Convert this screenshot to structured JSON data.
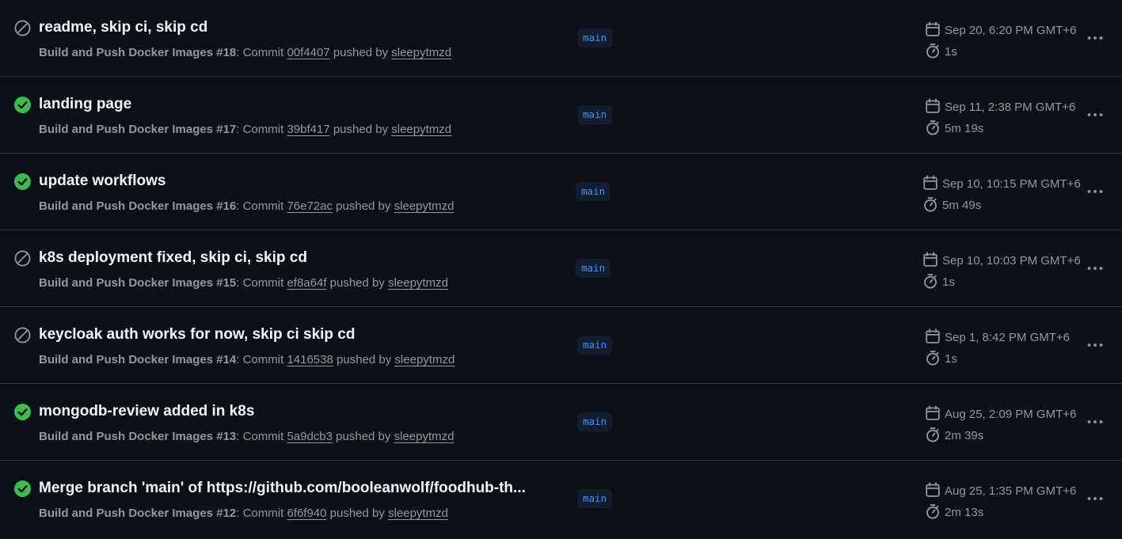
{
  "runs": [
    {
      "status": "skipped",
      "title": "readme, skip ci, skip cd",
      "workflow": "Build and Push Docker Images",
      "run_number": "#18",
      "commit_label": ": Commit",
      "sha": "00f4407",
      "pushed_by_label": "pushed by",
      "author": "sleepytmzd",
      "branch": "main",
      "date": "Sep 20, 6:20 PM GMT+6",
      "duration": "1s"
    },
    {
      "status": "success",
      "title": "landing page",
      "workflow": "Build and Push Docker Images",
      "run_number": "#17",
      "commit_label": ": Commit",
      "sha": "39bf417",
      "pushed_by_label": "pushed by",
      "author": "sleepytmzd",
      "branch": "main",
      "date": "Sep 11, 2:38 PM GMT+6",
      "duration": "5m 19s"
    },
    {
      "status": "success",
      "title": "update workflows",
      "workflow": "Build and Push Docker Images",
      "run_number": "#16",
      "commit_label": ": Commit",
      "sha": "76e72ac",
      "pushed_by_label": "pushed by",
      "author": "sleepytmzd",
      "branch": "main",
      "date": "Sep 10, 10:15 PM GMT+6",
      "duration": "5m 49s"
    },
    {
      "status": "skipped",
      "title": "k8s deployment fixed, skip ci, skip cd",
      "workflow": "Build and Push Docker Images",
      "run_number": "#15",
      "commit_label": ": Commit",
      "sha": "ef8a64f",
      "pushed_by_label": "pushed by",
      "author": "sleepytmzd",
      "branch": "main",
      "date": "Sep 10, 10:03 PM GMT+6",
      "duration": "1s"
    },
    {
      "status": "skipped",
      "title": "keycloak auth works for now, skip ci skip cd",
      "workflow": "Build and Push Docker Images",
      "run_number": "#14",
      "commit_label": ": Commit",
      "sha": "1416538",
      "pushed_by_label": "pushed by",
      "author": "sleepytmzd",
      "branch": "main",
      "date": "Sep 1, 8:42 PM GMT+6",
      "duration": "1s"
    },
    {
      "status": "success",
      "title": "mongodb-review added in k8s",
      "workflow": "Build and Push Docker Images",
      "run_number": "#13",
      "commit_label": ": Commit",
      "sha": "5a9dcb3",
      "pushed_by_label": "pushed by",
      "author": "sleepytmzd",
      "branch": "main",
      "date": "Aug 25, 2:09 PM GMT+6",
      "duration": "2m 39s"
    },
    {
      "status": "success",
      "title": "Merge branch 'main' of https://github.com/booleanwolf/foodhub-th...",
      "workflow": "Build and Push Docker Images",
      "run_number": "#12",
      "commit_label": ": Commit",
      "sha": "6f6f940",
      "pushed_by_label": "pushed by",
      "author": "sleepytmzd",
      "branch": "main",
      "date": "Aug 25, 1:35 PM GMT+6",
      "duration": "2m 13s"
    }
  ],
  "icons": {
    "skipped": "skipped-icon",
    "success": "check-circle-fill-icon",
    "date": "calendar-icon",
    "duration": "stopwatch-icon",
    "more": "kebab-horizontal-icon"
  },
  "colors": {
    "background": "#0d1117",
    "success": "#3fb950",
    "skipped": "#9198a1",
    "branch_text": "#4493f8",
    "branch_bg": "#121d2f",
    "title": "#f0f6fc",
    "muted": "#9198a1",
    "divider": "#30363d"
  }
}
